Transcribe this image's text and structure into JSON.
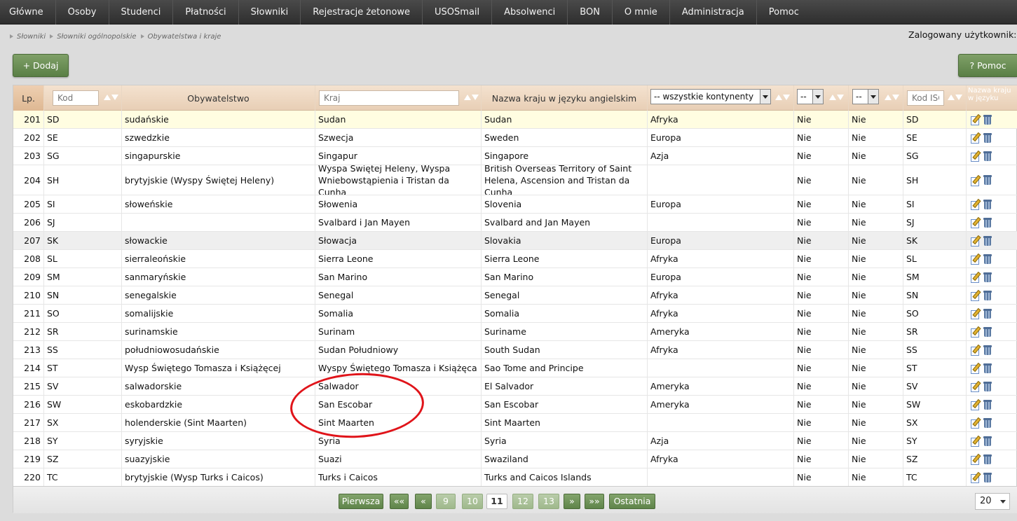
{
  "nav": [
    "Główne",
    "Osoby",
    "Studenci",
    "Płatności",
    "Słowniki",
    "Rejestracje żetonowe",
    "USOSmail",
    "Absolwenci",
    "BON",
    "O mnie",
    "Administracja",
    "Pomoc"
  ],
  "breadcrumb": [
    "Słowniki",
    "Słowniki ogólnopolskie",
    "Obywatelstwa i kraje"
  ],
  "logged_user": "Zalogowany użytkownik: JM",
  "buttons": {
    "add": "+ Dodaj",
    "help": "? Pomoc"
  },
  "header": {
    "lp": "Lp.",
    "kod_placeholder": "Kod",
    "obywatelstwo": "Obywatelstwo",
    "kraj_placeholder": "Kraj",
    "nazwa_ang": "Nazwa kraju w języku angielskim",
    "kontynent_select": "-- wszystkie kontynenty",
    "filter1_select": "--",
    "filter2_select": "--",
    "kodiso_placeholder": "Kod ISO",
    "last_col": "Nazwa kraju w języku"
  },
  "rows": [
    {
      "lp": "201",
      "kod": "SD",
      "obyw": "sudańskie",
      "kraj": "Sudan",
      "ang": "Sudan",
      "kont": "Afryka",
      "c1": "Nie",
      "c2": "Nie",
      "iso": "SD"
    },
    {
      "lp": "202",
      "kod": "SE",
      "obyw": "szwedzkie",
      "kraj": "Szwecja",
      "ang": "Sweden",
      "kont": "Europa",
      "c1": "Nie",
      "c2": "Nie",
      "iso": "SE"
    },
    {
      "lp": "203",
      "kod": "SG",
      "obyw": "singapurskie",
      "kraj": "Singapur",
      "ang": "Singapore",
      "kont": "Azja",
      "c1": "Nie",
      "c2": "Nie",
      "iso": "SG"
    },
    {
      "lp": "204",
      "kod": "SH",
      "obyw": "brytyjskie (Wyspy Świętej Heleny)",
      "kraj": "Wyspa Świętej Heleny, Wyspa Wniebowstąpienia i Tristan da Cunha",
      "ang": "British Overseas Territory of Saint Helena, Ascension and Tristan da Cunha",
      "kont": "",
      "c1": "Nie",
      "c2": "Nie",
      "iso": "SH"
    },
    {
      "lp": "205",
      "kod": "SI",
      "obyw": "słoweńskie",
      "kraj": "Słowenia",
      "ang": "Slovenia",
      "kont": "Europa",
      "c1": "Nie",
      "c2": "Nie",
      "iso": "SI"
    },
    {
      "lp": "206",
      "kod": "SJ",
      "obyw": "",
      "kraj": "Svalbard i Jan Mayen",
      "ang": "Svalbard and Jan Mayen",
      "kont": "",
      "c1": "Nie",
      "c2": "Nie",
      "iso": "SJ"
    },
    {
      "lp": "207",
      "kod": "SK",
      "obyw": "słowackie",
      "kraj": "Słowacja",
      "ang": "Slovakia",
      "kont": "Europa",
      "c1": "Nie",
      "c2": "Nie",
      "iso": "SK"
    },
    {
      "lp": "208",
      "kod": "SL",
      "obyw": "sierraleońskie",
      "kraj": "Sierra Leone",
      "ang": "Sierra Leone",
      "kont": "Afryka",
      "c1": "Nie",
      "c2": "Nie",
      "iso": "SL"
    },
    {
      "lp": "209",
      "kod": "SM",
      "obyw": "sanmaryńskie",
      "kraj": "San Marino",
      "ang": "San Marino",
      "kont": "Europa",
      "c1": "Nie",
      "c2": "Nie",
      "iso": "SM"
    },
    {
      "lp": "210",
      "kod": "SN",
      "obyw": "senegalskie",
      "kraj": "Senegal",
      "ang": "Senegal",
      "kont": "Afryka",
      "c1": "Nie",
      "c2": "Nie",
      "iso": "SN"
    },
    {
      "lp": "211",
      "kod": "SO",
      "obyw": "somalijskie",
      "kraj": "Somalia",
      "ang": "Somalia",
      "kont": "Afryka",
      "c1": "Nie",
      "c2": "Nie",
      "iso": "SO"
    },
    {
      "lp": "212",
      "kod": "SR",
      "obyw": "surinamskie",
      "kraj": "Surinam",
      "ang": "Suriname",
      "kont": "Ameryka",
      "c1": "Nie",
      "c2": "Nie",
      "iso": "SR"
    },
    {
      "lp": "213",
      "kod": "SS",
      "obyw": "południowosudańskie",
      "kraj": "Sudan Południowy",
      "ang": "South Sudan",
      "kont": "Afryka",
      "c1": "Nie",
      "c2": "Nie",
      "iso": "SS"
    },
    {
      "lp": "214",
      "kod": "ST",
      "obyw": "Wysp Świętego Tomasza i Książęcej",
      "kraj": "Wyspy Świętego Tomasza i Książęca",
      "ang": "Sao Tome and Principe",
      "kont": "",
      "c1": "Nie",
      "c2": "Nie",
      "iso": "ST"
    },
    {
      "lp": "215",
      "kod": "SV",
      "obyw": "salwadorskie",
      "kraj": "Salwador",
      "ang": "El Salvador",
      "kont": "Ameryka",
      "c1": "Nie",
      "c2": "Nie",
      "iso": "SV"
    },
    {
      "lp": "216",
      "kod": "SW",
      "obyw": "eskobardzkie",
      "kraj": "San Escobar",
      "ang": "San Escobar",
      "kont": "Ameryka",
      "c1": "Nie",
      "c2": "Nie",
      "iso": "SW"
    },
    {
      "lp": "217",
      "kod": "SX",
      "obyw": "holenderskie (Sint Maarten)",
      "kraj": "Sint Maarten",
      "ang": "Sint Maarten",
      "kont": "",
      "c1": "Nie",
      "c2": "Nie",
      "iso": "SX"
    },
    {
      "lp": "218",
      "kod": "SY",
      "obyw": "syryjskie",
      "kraj": "Syria",
      "ang": "Syria",
      "kont": "Azja",
      "c1": "Nie",
      "c2": "Nie",
      "iso": "SY"
    },
    {
      "lp": "219",
      "kod": "SZ",
      "obyw": "suazyjskie",
      "kraj": "Suazi",
      "ang": "Swaziland",
      "kont": "Afryka",
      "c1": "Nie",
      "c2": "Nie",
      "iso": "SZ"
    },
    {
      "lp": "220",
      "kod": "TC",
      "obyw": "brytyjskie (Wysp Turks i Caicos)",
      "kraj": "Turks i Caicos",
      "ang": "Turks and Caicos Islands",
      "kont": "",
      "c1": "Nie",
      "c2": "Nie",
      "iso": "TC"
    }
  ],
  "pagination": {
    "first": "Pierwsza",
    "prev_prev": "««",
    "prev": "«",
    "pages": [
      "9",
      "10",
      "11",
      "12",
      "13"
    ],
    "current": "11",
    "next": "»",
    "next_next": "»»",
    "last": "Ostatnia",
    "per_page": "20"
  }
}
